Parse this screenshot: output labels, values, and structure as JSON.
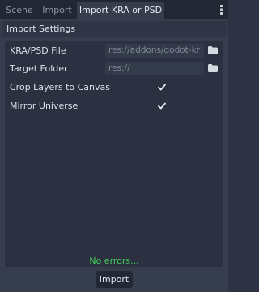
{
  "tabs": [
    {
      "label": "Scene",
      "active": false
    },
    {
      "label": "Import",
      "active": false
    },
    {
      "label": "Import KRA or PSD",
      "active": true
    }
  ],
  "icons": {
    "tab_menu": "kebab-menu-icon",
    "folder": "folder-icon",
    "check": "checkmark-icon"
  },
  "section": {
    "title": "Import Settings"
  },
  "fields": {
    "kra_psd_file": {
      "label": "KRA/PSD File",
      "value": "res://addons/godot-kr"
    },
    "target_folder": {
      "label": "Target Folder",
      "value": "res://"
    },
    "crop_layers": {
      "label": "Crop Layers to Canvas",
      "checked": true
    },
    "mirror_universe": {
      "label": "Mirror Universe",
      "checked": true
    }
  },
  "status": {
    "text": "No errors...",
    "color": "#45d158"
  },
  "actions": {
    "import_label": "Import"
  },
  "colors": {
    "background": "#2d3343",
    "panel": "#363d4d",
    "inner": "#2b3140",
    "field": "#333a4a"
  }
}
